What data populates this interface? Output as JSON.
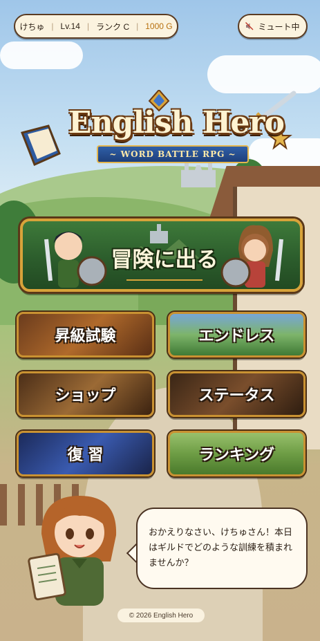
{
  "hud": {
    "player_name": "けちゅ",
    "level": "Lv.14",
    "rank": "ランク C",
    "gold": "1000 G"
  },
  "mute_button": {
    "icon": "speaker-muted-icon",
    "label": "ミュート中"
  },
  "logo": {
    "title": "English Hero",
    "subtitle": "~ WORD BATTLE RPG ~"
  },
  "main_button": {
    "label": "冒険に出る"
  },
  "menu": [
    {
      "label": "昇級試験"
    },
    {
      "label": "エンドレス"
    },
    {
      "label": "ショップ"
    },
    {
      "label": "ステータス"
    },
    {
      "label": "復 習"
    },
    {
      "label": "ランキング"
    }
  ],
  "guide": {
    "message": "おかえりなさい、けちゅさん！本日はギルドでどのような訓練を積まれませんか？"
  },
  "footer": {
    "copyright": "© 2026 English Hero"
  },
  "colors": {
    "gold_text": "#b7700e",
    "button_border": "#c99232",
    "main_button_green": "#2c5d2c"
  }
}
